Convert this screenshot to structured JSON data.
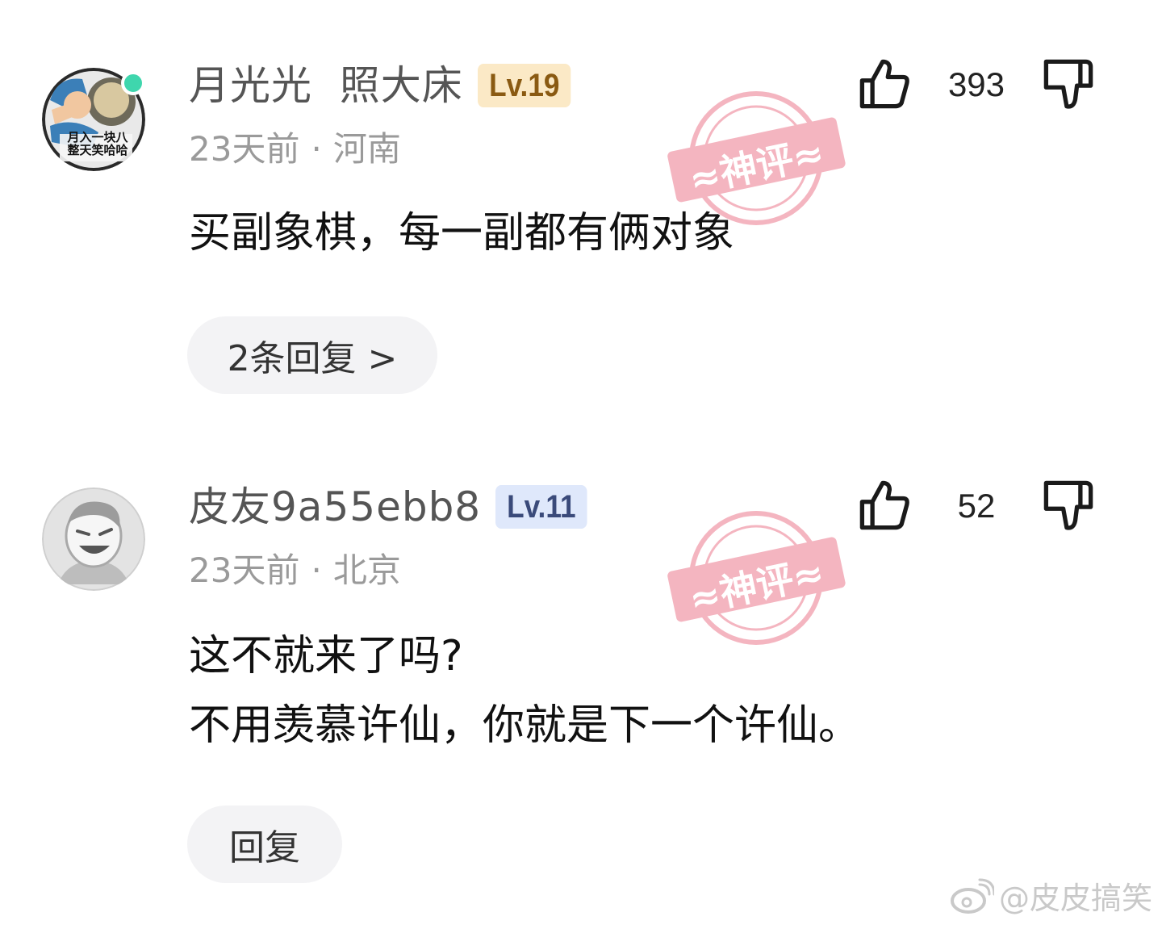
{
  "comments": [
    {
      "username": "月光光  照大床",
      "level": "Lv.19",
      "time": "23天前",
      "location": "河南",
      "text_lines": [
        "买副象棋，每一副都有俩对象"
      ],
      "likes": "393",
      "reply_button": "2条回复 >",
      "avatar_text": [
        "月入一块八",
        "整天笑哈哈"
      ],
      "stamp_text": "≈神评≈"
    },
    {
      "username": "皮友9a55ebb8",
      "level": "Lv.11",
      "time": "23天前",
      "location": "北京",
      "text_lines": [
        "这不就来了吗?",
        "不用羡慕许仙，你就是下一个许仙。"
      ],
      "likes": "52",
      "reply_button": "回复",
      "stamp_text": "≈神评≈"
    }
  ],
  "separator": "·",
  "watermark": "@皮皮搞笑",
  "colors": {
    "online": "#3fd6ad",
    "level_gold_bg": "#fbe9c6",
    "level_blue_bg": "#dfe8fb",
    "stamp": "#f3a9b6"
  },
  "icons": [
    "thumbs-up-icon",
    "thumbs-down-icon",
    "weibo-logo-icon"
  ]
}
